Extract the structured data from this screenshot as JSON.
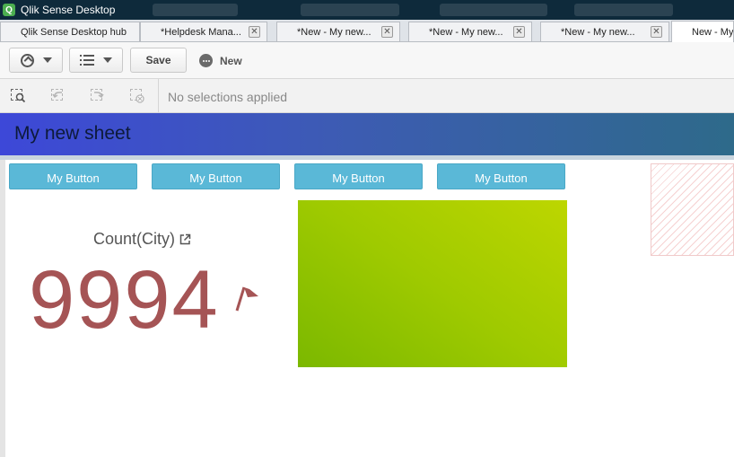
{
  "window": {
    "title": "Qlik Sense Desktop"
  },
  "tabs": [
    {
      "label": "Qlik Sense Desktop hub",
      "closable": false,
      "active": false
    },
    {
      "label": "*Helpdesk Mana...",
      "closable": true,
      "active": false
    },
    {
      "label": "*New - My new...",
      "closable": true,
      "active": false
    },
    {
      "label": "*New - My new...",
      "closable": true,
      "active": false
    },
    {
      "label": "*New - My new...",
      "closable": true,
      "active": false
    },
    {
      "label": "New - My",
      "closable": false,
      "active": true
    }
  ],
  "toolbar": {
    "navigation_icon": "compass-icon",
    "list_icon": "list-icon",
    "save_label": "Save",
    "new_label": "New"
  },
  "selections": {
    "status": "No selections applied"
  },
  "sheet": {
    "title": "My new sheet"
  },
  "buttons": [
    "My Button",
    "My Button",
    "My Button",
    "My Button"
  ],
  "kpi": {
    "label": "Count(City)",
    "value": "9994"
  },
  "colors": {
    "button": "#5ab8d7",
    "kpi_value": "#a55455",
    "header_start": "#3d48d8",
    "header_end": "#2e6a8a",
    "gradient_box_start": "#bdd600",
    "gradient_box_end": "#7bb800"
  }
}
